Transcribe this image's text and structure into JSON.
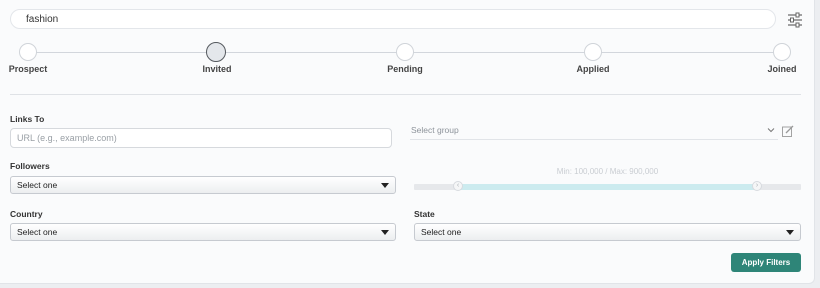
{
  "search": {
    "value": "fashion"
  },
  "stages": [
    {
      "label": "Prospect",
      "active": false
    },
    {
      "label": "Invited",
      "active": true
    },
    {
      "label": "Pending",
      "active": false
    },
    {
      "label": "Applied",
      "active": false
    },
    {
      "label": "Joined",
      "active": false
    }
  ],
  "links_to": {
    "label": "Links To",
    "placeholder": "URL (e.g., example.com)",
    "value": ""
  },
  "group": {
    "placeholder": "Select group"
  },
  "followers": {
    "label": "Followers",
    "selected": "Select one",
    "range_text": "Min: 100,000 / Max: 900,000",
    "range_min": 100000,
    "range_max": 900000
  },
  "country": {
    "label": "Country",
    "selected": "Select one"
  },
  "state": {
    "label": "State",
    "selected": "Select one"
  },
  "apply_button": {
    "label": "Apply Filters"
  },
  "colors": {
    "accent": "#2e8578",
    "slider_fill": "#ccebef",
    "active_node": "#e4e7eb"
  }
}
